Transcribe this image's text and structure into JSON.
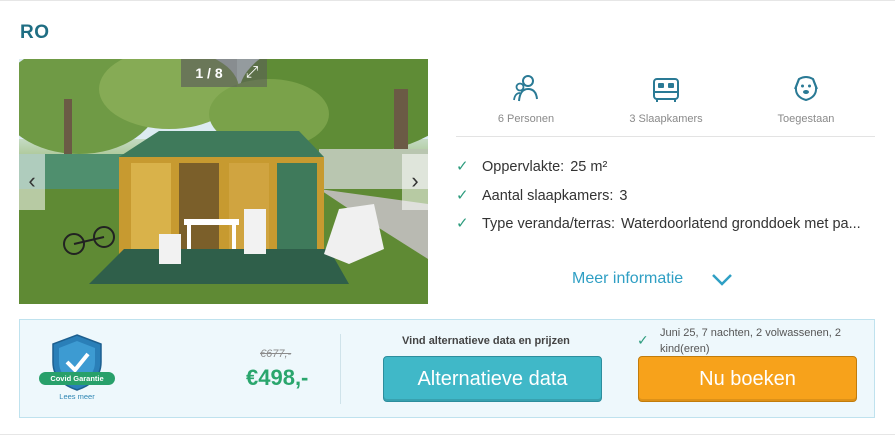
{
  "listing": {
    "title": "RO",
    "photo": {
      "counter": "1 / 8",
      "expand_icon": "expand-icon",
      "prev_icon": "chevron-left-icon",
      "next_icon": "chevron-right-icon"
    }
  },
  "amenities": [
    {
      "icon": "persons-icon",
      "label": "6 Personen"
    },
    {
      "icon": "bed-icon",
      "label": "3 Slaapkamers"
    },
    {
      "icon": "dog-icon",
      "label": "Toegestaan"
    }
  ],
  "features": [
    {
      "label": "Oppervlakte:",
      "value": "25 m²"
    },
    {
      "label": "Aantal slaapkamers:",
      "value": "3"
    },
    {
      "label": "Type veranda/terras:",
      "value": "Waterdoorlatend gronddoek met pa..."
    }
  ],
  "more_info": {
    "label": "Meer informatie"
  },
  "booking": {
    "covid": {
      "badge": "Covid Garantie",
      "link": "Lees meer"
    },
    "price": {
      "old": "€677,-",
      "new": "€498,-"
    },
    "alternative": {
      "caption": "Vind alternatieve data en prijzen",
      "button": "Alternatieve data"
    },
    "trip": {
      "summary": "Juni 25, 7 nachten, 2 volwassenen, 2 kind(eren)"
    },
    "book_button": "Nu boeken"
  },
  "colors": {
    "title": "#1f6e83",
    "accent_green": "#2aa66d",
    "teal_button": "#40b8c8",
    "orange_button": "#f7a21b",
    "link_blue": "#2f9fc4"
  }
}
